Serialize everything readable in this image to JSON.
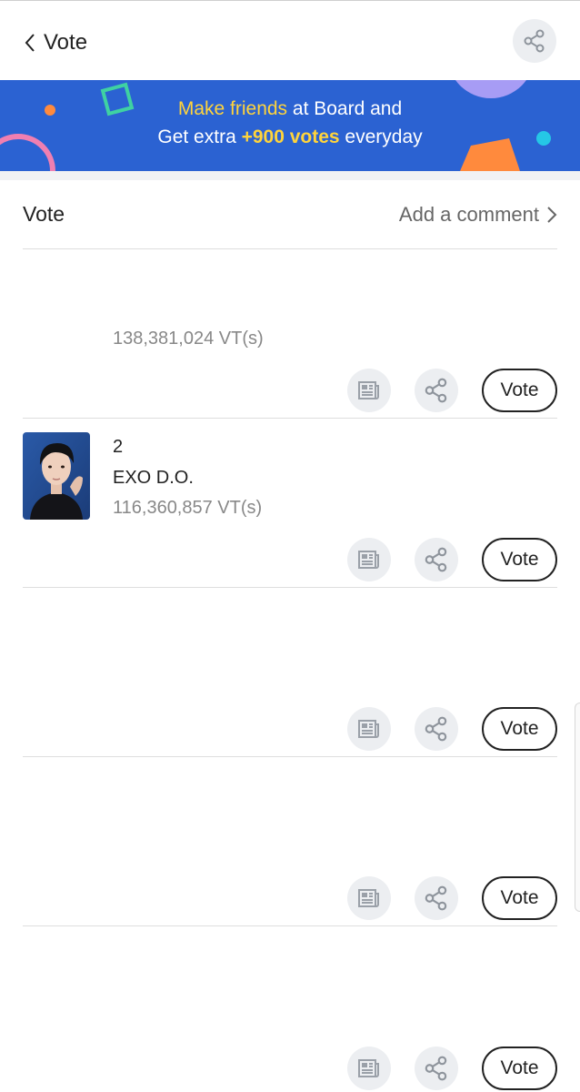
{
  "header": {
    "title": "Vote",
    "back_icon": "chevron-left-icon",
    "share_icon": "share-icon"
  },
  "banner": {
    "line1_highlight": "Make friends",
    "line1_rest": " at Board and",
    "line2_start": "Get extra ",
    "line2_highlight": "+900 votes",
    "line2_end": " everyday",
    "colors": {
      "background": "#2b62d2",
      "highlight": "#ffd43b"
    }
  },
  "section": {
    "title": "Vote",
    "comment_link": "Add a comment"
  },
  "entries": [
    {
      "rank": "",
      "name": "",
      "votes": "138,381,024 VT(s)",
      "vote_label": "Vote"
    },
    {
      "rank": "2",
      "name": "EXO D.O.",
      "votes": "116,360,857 VT(s)",
      "vote_label": "Vote"
    },
    {
      "rank": "",
      "name": "",
      "votes": "",
      "vote_label": "Vote"
    },
    {
      "rank": "",
      "name": "",
      "votes": "",
      "vote_label": "Vote"
    },
    {
      "rank": "",
      "name": "",
      "votes": "",
      "vote_label": "Vote"
    }
  ],
  "icons": {
    "news": "newspaper-icon",
    "share": "share-icon"
  }
}
